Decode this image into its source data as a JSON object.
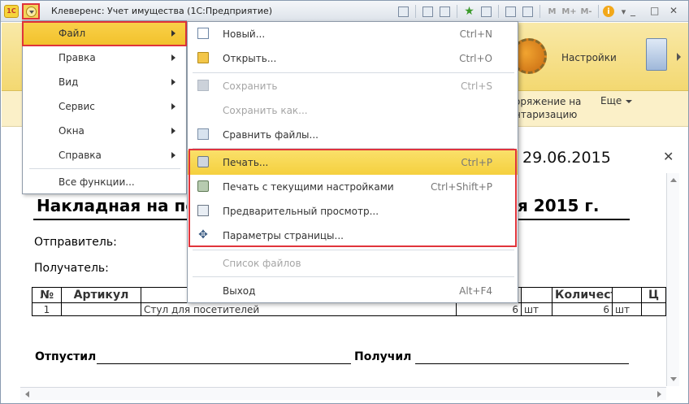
{
  "window": {
    "logo_text": "1С",
    "title": "Клеверенс: Учет имущества  (1С:Предприятие)",
    "toolbar_icons": [
      "save-icon",
      "print-icon",
      "preview-icon",
      "favorites-icon",
      "history-icon",
      "calculator-icon",
      "calendar-icon",
      "memory-m-icon",
      "memory-mplus-icon",
      "memory-mminus-icon",
      "info-icon"
    ],
    "memory_labels": [
      "M",
      "M+",
      "M-"
    ],
    "controls": {
      "minimize": "_",
      "maximize": "□",
      "close": "✕"
    }
  },
  "sections_panel": {
    "settings_label": "Настройки",
    "command_text_line1": "оряжение на",
    "command_text_line2": "нтаризацию",
    "more_label": "Еще"
  },
  "main_menu": {
    "items": [
      {
        "label": "Файл",
        "active": true,
        "has_submenu": true
      },
      {
        "label": "Правка",
        "has_submenu": true
      },
      {
        "label": "Вид",
        "has_submenu": true
      },
      {
        "label": "Сервис",
        "has_submenu": true
      },
      {
        "label": "Окна",
        "has_submenu": true
      },
      {
        "label": "Справка",
        "has_submenu": true
      },
      {
        "label": "Все функции...",
        "has_submenu": false
      }
    ]
  },
  "file_submenu": {
    "items": [
      {
        "label": "Новый...",
        "shortcut": "Ctrl+N",
        "icon": "new-document-icon",
        "disabled": false
      },
      {
        "label": "Открыть...",
        "shortcut": "Ctrl+O",
        "icon": "open-folder-icon",
        "disabled": false
      },
      {
        "label": "Сохранить",
        "shortcut": "Ctrl+S",
        "icon": "save-icon",
        "disabled": true
      },
      {
        "label": "Сохранить как...",
        "shortcut": "",
        "icon": "",
        "disabled": true
      },
      {
        "label": "Сравнить файлы...",
        "shortcut": "",
        "icon": "compare-files-icon",
        "disabled": false
      },
      {
        "label": "Печать...",
        "shortcut": "Ctrl+P",
        "icon": "printer-icon",
        "disabled": false,
        "highlighted": true
      },
      {
        "label": "Печать с текущими настройками",
        "shortcut": "Ctrl+Shift+P",
        "icon": "quick-print-icon",
        "disabled": false
      },
      {
        "label": "Предварительный просмотр...",
        "shortcut": "",
        "icon": "print-preview-icon",
        "disabled": false
      },
      {
        "label": "Параметры страницы...",
        "shortcut": "",
        "icon": "page-settings-icon",
        "disabled": false
      },
      {
        "label": "Список файлов",
        "shortcut": "",
        "icon": "",
        "disabled": true
      },
      {
        "label": "Выход",
        "shortcut": "Alt+F4",
        "icon": "",
        "disabled": false
      }
    ]
  },
  "document": {
    "date_fragment": "29.06.2015",
    "title_fragment_left": "Накладная на пе",
    "title_fragment_right": "я 2015 г.",
    "sender_label": "Отправитель:",
    "receiver_label": "Получатель:",
    "table": {
      "headers": [
        "№",
        "Артикул",
        "",
        "",
        "",
        "Количество",
        "",
        "Ц"
      ],
      "rows": [
        [
          "1",
          "",
          "Стул для посетителей",
          "6",
          "шт",
          "6",
          "шт",
          ""
        ]
      ]
    },
    "released_label": "Отпустил",
    "received_label": "Получил"
  }
}
